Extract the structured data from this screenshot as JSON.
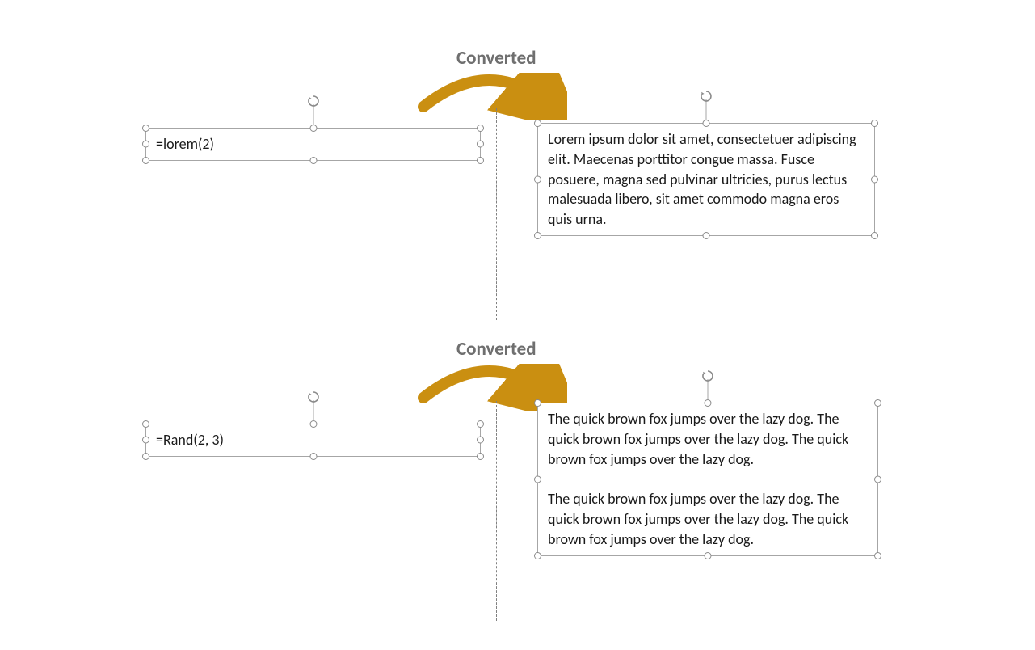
{
  "labels": {
    "converted_1": "Converted",
    "converted_2": "Converted"
  },
  "example1": {
    "input": "=lorem(2)",
    "output": "Lorem ipsum dolor sit amet, consectetuer adipiscing elit. Maecenas porttitor congue massa. Fusce posuere, magna sed pulvinar ultricies, purus lectus malesuada libero, sit amet commodo magna eros quis urna."
  },
  "example2": {
    "input": "=Rand(2, 3)",
    "output": "The quick brown fox jumps over the lazy dog. The quick brown fox jumps over the lazy dog. The quick brown fox jumps over the lazy dog.\n\nThe quick brown fox jumps over the lazy dog. The quick brown fox jumps over the lazy dog. The quick brown fox jumps over the lazy dog."
  },
  "colors": {
    "arrow": "#ca8f11",
    "label": "#6f6f6f",
    "border": "#a6a6a6"
  }
}
